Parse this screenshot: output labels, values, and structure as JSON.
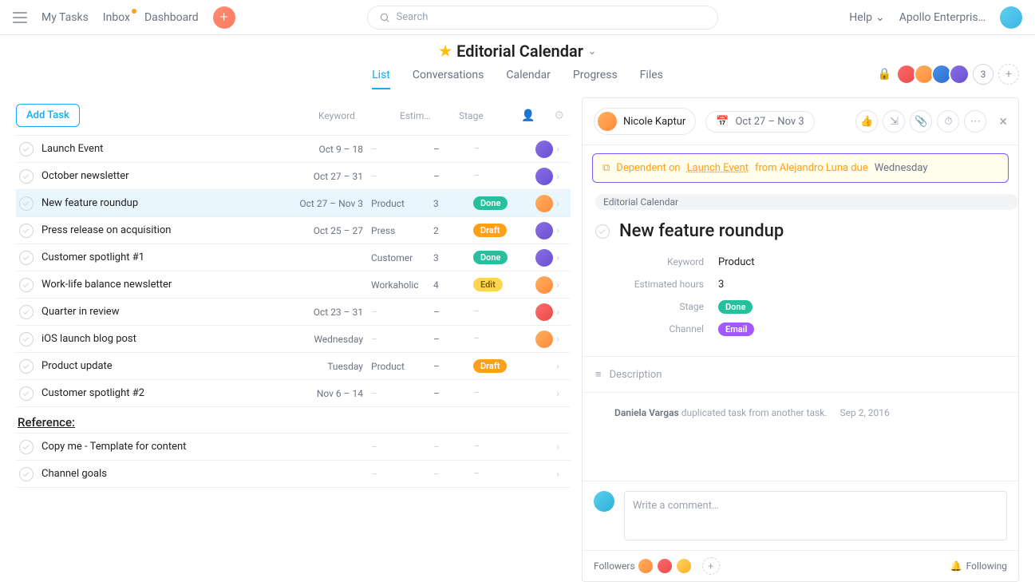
{
  "nav": {
    "my_tasks": "My Tasks",
    "inbox": "Inbox",
    "dashboard": "Dashboard",
    "search_placeholder": "Search",
    "help": "Help",
    "workspace": "Apollo Enterpris…"
  },
  "project": {
    "title": "Editorial Calendar",
    "tabs": {
      "list": "List",
      "conversations": "Conversations",
      "calendar": "Calendar",
      "progress": "Progress",
      "files": "Files"
    },
    "extra_count": "3"
  },
  "list": {
    "add_task": "Add Task",
    "heads": {
      "keyword": "Keyword",
      "estim": "Estim…",
      "stage": "Stage"
    },
    "rows": [
      {
        "title": "Launch Event",
        "date": "Oct 9 – 18",
        "key": "",
        "est": "–",
        "stage": "",
        "av": "purple"
      },
      {
        "title": "October newsletter",
        "date": "Oct 27 – 31",
        "key": "",
        "est": "–",
        "stage": "",
        "av": "purple"
      },
      {
        "title": "New feature roundup",
        "date": "Oct 27 – Nov 3",
        "key": "Product",
        "est": "3",
        "stage": "Done",
        "av": "orange",
        "sel": true
      },
      {
        "title": "Press release on acquisition",
        "date": "Oct 25 – 27",
        "key": "Press",
        "est": "2",
        "stage": "Draft",
        "av": "purple"
      },
      {
        "title": "Customer spotlight #1",
        "date": "",
        "key": "Customer",
        "est": "3",
        "stage": "Done",
        "av": "purple"
      },
      {
        "title": "Work-life balance newsletter",
        "date": "",
        "key": "Workaholic",
        "est": "4",
        "stage": "Edit",
        "av": "orange"
      },
      {
        "title": "Quarter in review",
        "date": "Oct 23 – 31",
        "key": "",
        "est": "–",
        "stage": "",
        "av": "red"
      },
      {
        "title": "iOS launch blog post",
        "date": "Wednesday",
        "key": "",
        "est": "–",
        "stage": "",
        "av": "orange"
      },
      {
        "title": "Product update",
        "date": "Tuesday",
        "key": "Product",
        "est": "–",
        "stage": "Draft",
        "av": ""
      },
      {
        "title": "Customer spotlight #2",
        "date": "Nov 6 – 14",
        "key": "",
        "est": "–",
        "stage": "",
        "av": ""
      }
    ],
    "section": "Reference:",
    "section_rows": [
      {
        "title": "Copy me - Template for content"
      },
      {
        "title": "Channel goals"
      }
    ]
  },
  "detail": {
    "assignee": "Nicole Kaptur",
    "date": "Oct 27 – Nov 3",
    "dep_prefix": "Dependent on",
    "dep_task": "Launch Event",
    "dep_mid": "from Alejandro Luna due",
    "dep_due": "Wednesday",
    "project_chip": "Editorial Calendar",
    "title": "New feature roundup",
    "fields": {
      "keyword_l": "Keyword",
      "keyword_v": "Product",
      "est_l": "Estimated hours",
      "est_v": "3",
      "stage_l": "Stage",
      "stage_v": "Done",
      "channel_l": "Channel",
      "channel_v": "Email"
    },
    "desc_label": "Description",
    "activity_who": "Daniela Vargas",
    "activity_what": "duplicated task from another task.",
    "activity_when": "Sep 2, 2016",
    "comment_placeholder": "Write a comment…",
    "followers_label": "Followers",
    "following": "Following"
  }
}
